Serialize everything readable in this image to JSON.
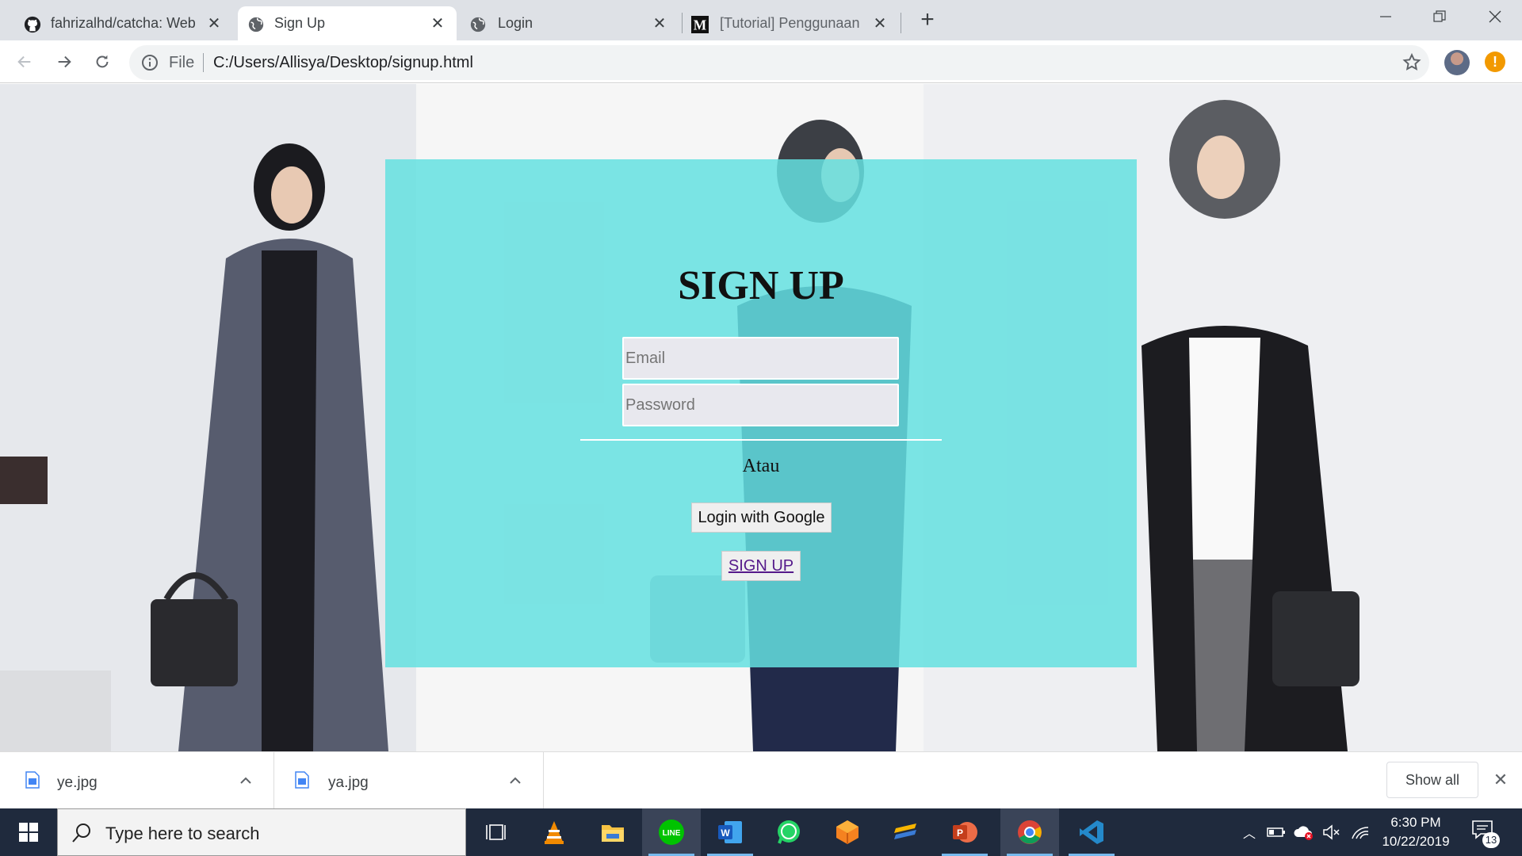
{
  "browser": {
    "tabs": [
      {
        "label": "fahrizalhd/catcha: Web"
      },
      {
        "label": "Sign Up"
      },
      {
        "label": "Login"
      },
      {
        "label": "[Tutorial] Penggunaan"
      }
    ],
    "new_tab_label": "+",
    "url_scheme_label": "File",
    "url": "C:/Users/Allisya/Desktop/signup.html"
  },
  "page": {
    "title": "SIGN UP",
    "email_placeholder": "Email",
    "password_placeholder": "Password",
    "separator_text": "Atau",
    "google_button": "Login with Google",
    "signup_link": "SIGN UP"
  },
  "downloads": {
    "items": [
      {
        "name": "ye.jpg"
      },
      {
        "name": "ya.jpg"
      }
    ],
    "show_all": "Show all"
  },
  "taskbar": {
    "search_placeholder": "Type here to search",
    "clock_time": "6:30 PM",
    "clock_date": "10/22/2019",
    "notification_count": "13"
  },
  "colors": {
    "card": "#64e0e0",
    "accent_tab": "#ffffff",
    "taskbar": "#1f2a3d"
  }
}
